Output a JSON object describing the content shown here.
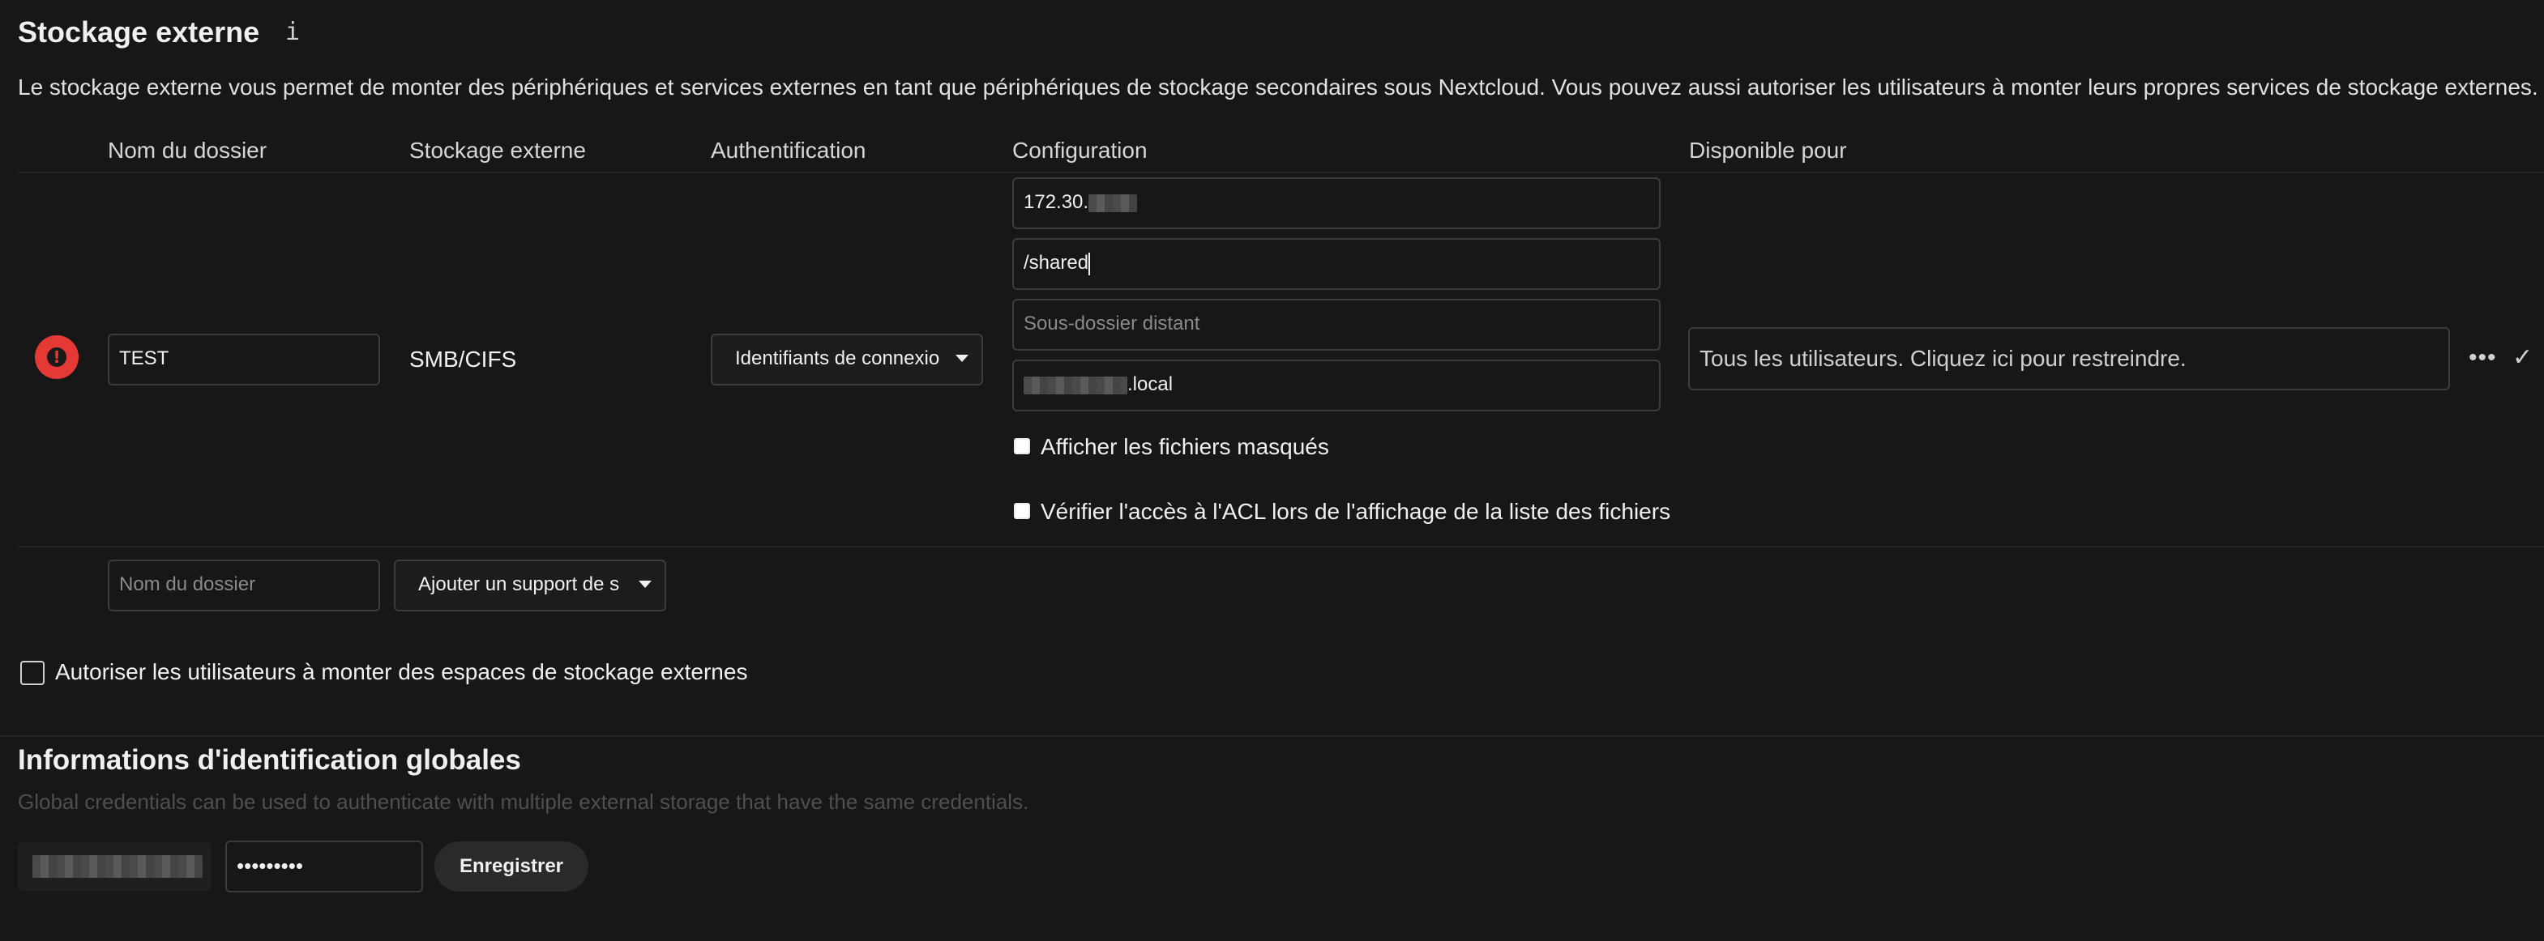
{
  "section": {
    "title": "Stockage externe",
    "info_icon_glyph": "i",
    "description": "Le stockage externe vous permet de monter des périphériques et services externes en tant que périphériques de stockage secondaires sous Nextcloud. Vous pouvez aussi autoriser les utilisateurs à monter leurs propres services de stockage externes."
  },
  "table": {
    "headers": {
      "folder_name": "Nom du dossier",
      "external_storage": "Stockage externe",
      "authentication": "Authentification",
      "configuration": "Configuration",
      "available_for": "Disponible pour"
    },
    "row": {
      "status_icon": "error-icon",
      "folder_name": "TEST",
      "storage_type": "SMB/CIFS",
      "authentication": "Identifiants de connexio",
      "config": {
        "host_prefix": "172.30.",
        "share": "/shared",
        "remote_subfolder_placeholder": "Sous-dossier distant",
        "domain_suffix": ".local",
        "show_hidden_label": "Afficher les fichiers masqués",
        "check_acl_label": "Vérifier l'accès à l'ACL lors de l'affichage de la liste des fichiers"
      },
      "available_for": "Tous les utilisateurs. Cliquez ici pour restreindre.",
      "more_glyph": "•••",
      "check_glyph": "✓"
    },
    "new_row": {
      "folder_placeholder": "Nom du dossier",
      "add_storage": "Ajouter un support de s"
    }
  },
  "allow_users_label": "Autoriser les utilisateurs à monter des espaces de stockage externes",
  "global_credentials": {
    "title": "Informations d'identification globales",
    "hint": "Global credentials can be used to authenticate with multiple external storage that have the same credentials.",
    "password_mask": "•••••••••",
    "save_label": "Enregistrer"
  },
  "colors": {
    "background": "#171717",
    "error": "#e53935",
    "border": "#3c3c3c"
  }
}
